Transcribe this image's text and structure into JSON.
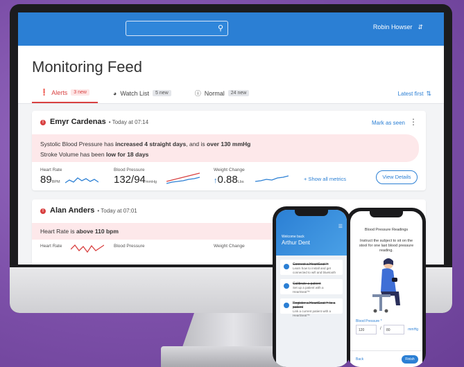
{
  "header": {
    "search_placeholder": "",
    "user_name": "Robin Howser"
  },
  "page_title": "Monitoring Feed",
  "tabs": [
    {
      "label": "Alerts",
      "badge": "3 new",
      "icon": "alert-circle-icon"
    },
    {
      "label": "Watch List",
      "badge": "5 new",
      "icon": "watch-icon"
    },
    {
      "label": "Normal",
      "badge": "24 new",
      "icon": "info-icon"
    }
  ],
  "sort_label": "Latest first",
  "patients": [
    {
      "name": "Emyr Cardenas",
      "time": "• Today at 07:14",
      "mark_seen": "Mark as seen",
      "alert_line1_pre": "Systolic Blood Pressure has ",
      "alert_line1_b1": "increased 4 straight days",
      "alert_line1_mid": ", and is ",
      "alert_line1_b2": "over 130 mmHg",
      "alert_line2_pre": "Stroke Volume has been ",
      "alert_line2_b": "low for 18 days",
      "hr_label": "Heart Rate",
      "hr_value": "89",
      "hr_unit": "BPM",
      "bp_label": "Blood Pressure",
      "bp_value": "132/94",
      "bp_unit": "mmHg",
      "wc_label": "Weight Change",
      "wc_value": "0.88",
      "wc_unit": "Lbs",
      "show_all": "+ Show all metrics",
      "view_details": "View Details"
    },
    {
      "name": "Alan Anders",
      "time": "• Today at 07:01",
      "alert_pre": "Heart Rate is ",
      "alert_b": "above 110 bpm",
      "hr_label": "Heart Rate",
      "bp_label": "Blood Pressure",
      "wc_label": "Weight Change"
    }
  ],
  "phone1": {
    "welcome": "Welcome back",
    "name": "Arthur Dent",
    "items": [
      {
        "title": "Connect a HeartSeat™",
        "desc": "Learn how to install and get connected to wifi and bluetooth"
      },
      {
        "title": "Calibrate a patient",
        "desc": "Set up a patient with a HeartSeat™"
      },
      {
        "title": "Register a HeartSeat™ to a patient",
        "desc": "Link a current patient with a HeartSeat™"
      }
    ]
  },
  "phone2": {
    "title": "Blood Pressure Readings",
    "instruction": "Instruct the subject to sit on the stool for one last blood pressure reading.",
    "bp_label": "Blood Pressure *",
    "systolic": "120",
    "diastolic": "80",
    "unit": "mmHg",
    "back": "Back",
    "finish": "Finish"
  },
  "colors": {
    "accent": "#2b7fd4",
    "alert": "#d84040",
    "alert_bg": "#fde8ea"
  }
}
